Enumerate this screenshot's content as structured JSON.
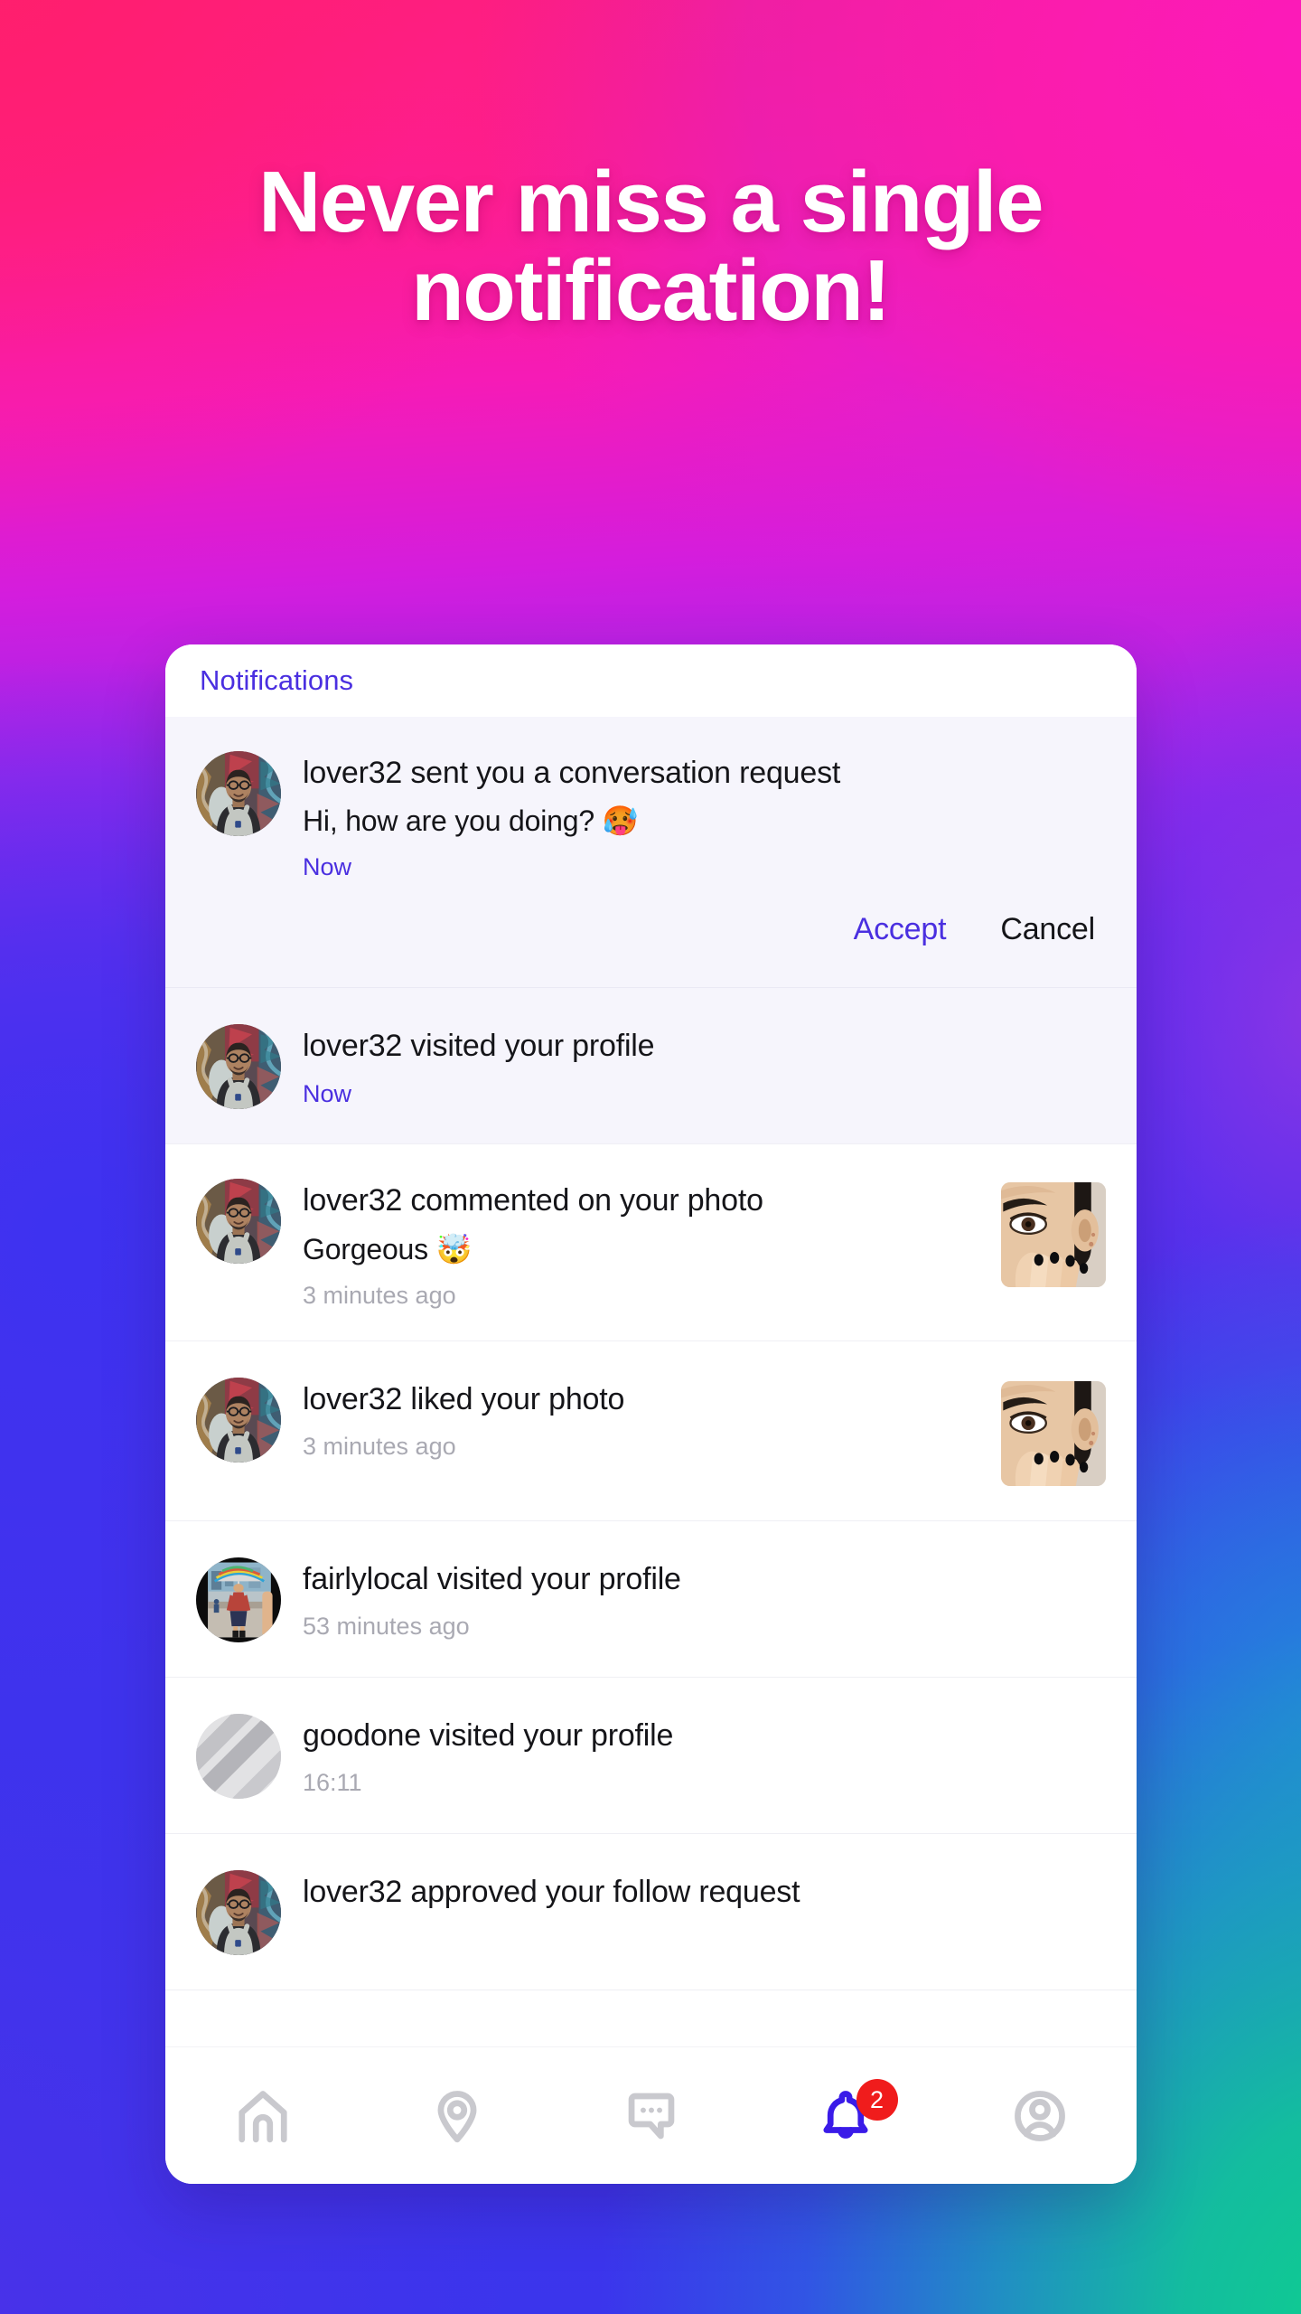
{
  "headline": "Never miss a single notification!",
  "colors": {
    "accent_purple": "#4A2FE0",
    "badge_red": "#F01C1C",
    "text_primary": "#151519",
    "text_muted": "#A9A9B2",
    "unread_row_bg": "#F6F5FC",
    "bg_pink": "#FF1E74",
    "bg_magenta": "#FC1ABA",
    "bg_blue": "#4A32E8",
    "bg_teal": "#0ECE8F"
  },
  "card": {
    "header": {
      "title": "Notifications"
    },
    "notifications": [
      {
        "id": "conversation-request",
        "unread": true,
        "avatar": "man-glasses-overalls-graffiti",
        "title": "lover32 sent you a conversation request",
        "subtitle": "Hi, how are you doing? 🥵",
        "time": "Now",
        "time_style": "accent",
        "thumbnail": null,
        "actions": {
          "accept_label": "Accept",
          "cancel_label": "Cancel"
        }
      },
      {
        "id": "visited-profile-lover32",
        "unread": true,
        "avatar": "man-glasses-overalls-graffiti",
        "title": "lover32 visited your profile",
        "subtitle": null,
        "time": "Now",
        "time_style": "accent",
        "thumbnail": null,
        "actions": null
      },
      {
        "id": "commented-on-photo",
        "unread": false,
        "avatar": "man-glasses-overalls-graffiti",
        "title": "lover32 commented on your photo",
        "subtitle": "Gorgeous 🤯",
        "time": "3 minutes ago",
        "time_style": "muted",
        "thumbnail": "face-hand-black-nails",
        "actions": null
      },
      {
        "id": "liked-photo",
        "unread": false,
        "avatar": "man-glasses-overalls-graffiti",
        "title": "lover32 liked your photo",
        "subtitle": null,
        "time": "3 minutes ago",
        "time_style": "muted",
        "thumbnail": "face-hand-black-nails",
        "actions": null
      },
      {
        "id": "visited-profile-fairlylocal",
        "unread": false,
        "avatar": "person-walking-street-umbrella",
        "title": "fairlylocal visited your profile",
        "subtitle": null,
        "time": "53 minutes ago",
        "time_style": "muted",
        "thumbnail": null,
        "actions": null
      },
      {
        "id": "visited-profile-goodone",
        "unread": false,
        "avatar": "placeholder-grey",
        "title": "goodone visited your profile",
        "subtitle": null,
        "time": "16:11",
        "time_style": "muted",
        "thumbnail": null,
        "actions": null
      },
      {
        "id": "approved-follow-request",
        "unread": false,
        "avatar": "man-glasses-overalls-graffiti",
        "title": "lover32 approved your follow request",
        "subtitle": null,
        "time": null,
        "time_style": "muted",
        "thumbnail": null,
        "actions": null
      }
    ],
    "bottom_nav": [
      {
        "id": "home",
        "icon": "home-icon",
        "active": false,
        "badge": null
      },
      {
        "id": "nearby",
        "icon": "location-pin-icon",
        "active": false,
        "badge": null
      },
      {
        "id": "messages",
        "icon": "chat-bubble-icon",
        "active": false,
        "badge": null
      },
      {
        "id": "notifications",
        "icon": "bell-icon",
        "active": true,
        "badge": "2"
      },
      {
        "id": "profile",
        "icon": "user-circle-icon",
        "active": false,
        "badge": null
      }
    ]
  }
}
